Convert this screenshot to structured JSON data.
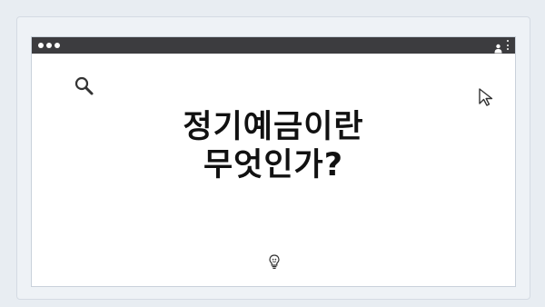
{
  "page": {
    "headline_line1": "정기예금이란",
    "headline_line2": "무엇인가?"
  },
  "icons": {
    "search": "search-icon",
    "cursor": "cursor-icon",
    "bulb": "lightbulb-icon",
    "user": "user-icon",
    "menu": "kebab-menu-icon"
  },
  "colors": {
    "titlebar": "#3c3c3f",
    "background": "#e8edf2",
    "page": "#ffffff",
    "text": "#111111"
  }
}
